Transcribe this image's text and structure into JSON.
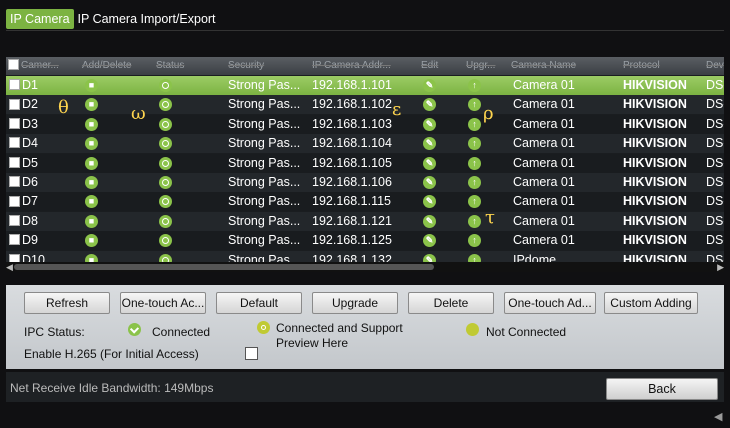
{
  "tabs": [
    "IP Camera",
    "IP Camera Import/Export"
  ],
  "table": {
    "headers": [
      "Camer...",
      "Add/Delete",
      "Status",
      "Security",
      "IP Camera Addr...",
      "Edit",
      "Upgr...",
      "Camera Name",
      "Protocol",
      "Dev"
    ],
    "rows": [
      {
        "camera": "D1",
        "security": "Strong Pas...",
        "ip": "192.168.1.101",
        "name": "Camera 01",
        "protocol": "HIKVISION",
        "dev": "DS-"
      },
      {
        "camera": "D2",
        "security": "Strong Pas...",
        "ip": "192.168.1.102",
        "name": "Camera 01",
        "protocol": "HIKVISION",
        "dev": "DS-"
      },
      {
        "camera": "D3",
        "security": "Strong Pas...",
        "ip": "192.168.1.103",
        "name": "Camera 01",
        "protocol": "HIKVISION",
        "dev": "DS-"
      },
      {
        "camera": "D4",
        "security": "Strong Pas...",
        "ip": "192.168.1.104",
        "name": "Camera 01",
        "protocol": "HIKVISION",
        "dev": "DS-"
      },
      {
        "camera": "D5",
        "security": "Strong Pas...",
        "ip": "192.168.1.105",
        "name": "Camera 01",
        "protocol": "HIKVISION",
        "dev": "DS-"
      },
      {
        "camera": "D6",
        "security": "Strong Pas...",
        "ip": "192.168.1.106",
        "name": "Camera 01",
        "protocol": "HIKVISION",
        "dev": "DS-"
      },
      {
        "camera": "D7",
        "security": "Strong Pas...",
        "ip": "192.168.1.115",
        "name": "Camera 01",
        "protocol": "HIKVISION",
        "dev": "DS-"
      },
      {
        "camera": "D8",
        "security": "Strong Pas...",
        "ip": "192.168.1.121",
        "name": "Camera 01",
        "protocol": "HIKVISION",
        "dev": "DS-"
      },
      {
        "camera": "D9",
        "security": "Strong Pas...",
        "ip": "192.168.1.125",
        "name": "Camera 01",
        "protocol": "HIKVISION",
        "dev": "DS-"
      },
      {
        "camera": "D10",
        "security": "Strong Pas...",
        "ip": "192.168.1.132",
        "name": "IPdome",
        "protocol": "HIKVISION",
        "dev": "DS-"
      }
    ],
    "selected_row": 0
  },
  "overlay_glyphs": [
    "θ",
    "ω",
    "ε",
    "ρ",
    "τ"
  ],
  "buttons": {
    "refresh": "Refresh",
    "one_touch_activate": "One-touch Ac...",
    "default": "Default",
    "upgrade": "Upgrade",
    "delete": "Delete",
    "one_touch_add": "One-touch Ad...",
    "custom_adding": "Custom Adding"
  },
  "legend": {
    "title": "IPC Status:",
    "connected": "Connected",
    "preview_line1": "Connected and Support",
    "preview_line2": "Preview Here",
    "not_connected": "Not Connected"
  },
  "h265_label": "Enable H.265 (For Initial Access)",
  "h265_checked": false,
  "footer": {
    "bandwidth": "Net Receive Idle Bandwidth: 149Mbps",
    "back": "Back"
  },
  "colors": {
    "accent": "#7cb342",
    "icon_green": "#8bc34a"
  },
  "icons": {
    "delete": "trash-icon",
    "status": "play-circle-icon",
    "edit": "pencil-icon",
    "upgrade": "arrow-up-icon"
  }
}
